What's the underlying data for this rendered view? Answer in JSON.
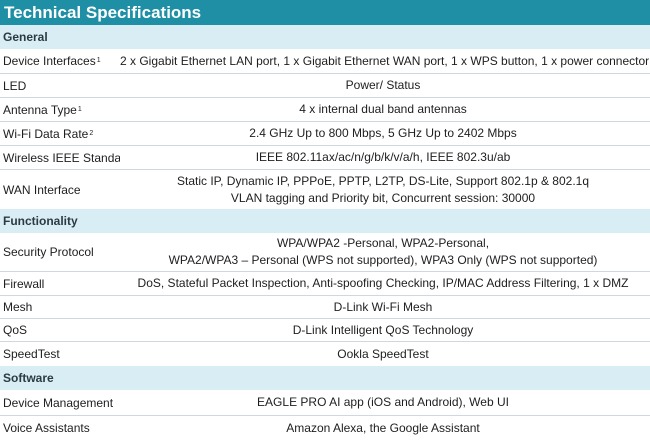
{
  "title": "Technical Specifications",
  "sections": [
    {
      "name": "General",
      "rows": [
        {
          "label": "Device Interfaces",
          "sup": "1",
          "value": [
            "2 x Gigabit Ethernet LAN port, 1 x Gigabit Ethernet WAN port, 1 x WPS button, 1 x power connector"
          ]
        },
        {
          "label": "LED",
          "sup": "",
          "value": [
            "Power/ Status"
          ]
        },
        {
          "label": "Antenna Type",
          "sup": "1",
          "value": [
            "4 x internal dual band antennas"
          ]
        },
        {
          "label": "Wi-Fi Data Rate",
          "sup": "2",
          "value": [
            "2.4 GHz Up to 800 Mbps, 5 GHz Up to 2402 Mbps"
          ]
        },
        {
          "label": "Wireless IEEE Standard",
          "sup": "",
          "value": [
            "IEEE 802.11ax/ac/n/g/b/k/v/a/h, IEEE 802.3u/ab"
          ]
        },
        {
          "label": "WAN Interface",
          "sup": "",
          "value": [
            "Static IP, Dynamic IP, PPPoE, PPTP, L2TP, DS-Lite, Support 802.1p & 802.1q",
            "VLAN tagging and Priority bit, Concurrent session: 30000"
          ]
        }
      ]
    },
    {
      "name": "Functionality",
      "rows": [
        {
          "label": "Security Protocol",
          "sup": "",
          "value": [
            "WPA/WPA2 -Personal, WPA2-Personal,",
            "WPA2/WPA3 – Personal (WPS not supported), WPA3 Only (WPS not supported)"
          ]
        },
        {
          "label": "Firewall",
          "sup": "",
          "value": [
            "DoS, Stateful Packet Inspection, Anti-spoofing Checking, IP/MAC Address Filtering, 1 x DMZ"
          ]
        },
        {
          "label": "Mesh",
          "sup": "",
          "value": [
            "D-Link Wi-Fi Mesh"
          ]
        },
        {
          "label": "QoS",
          "sup": "",
          "value": [
            "D-Link Intelligent QoS Technology"
          ]
        },
        {
          "label": "SpeedTest",
          "sup": "",
          "value": [
            "Ookla SpeedTest"
          ]
        }
      ]
    },
    {
      "name": "Software",
      "rows": [
        {
          "label": "Device Management",
          "sup": "",
          "value": [
            "EAGLE PRO AI app (iOS and Android), Web UI"
          ]
        },
        {
          "label": "Voice Assistants",
          "sup": "",
          "value": [
            "Amazon Alexa, the Google Assistant"
          ]
        }
      ]
    }
  ],
  "colors": {
    "header_bg": "#1f8fa6",
    "section_bg": "#d9eef4",
    "divider": "#cfd8dc"
  }
}
